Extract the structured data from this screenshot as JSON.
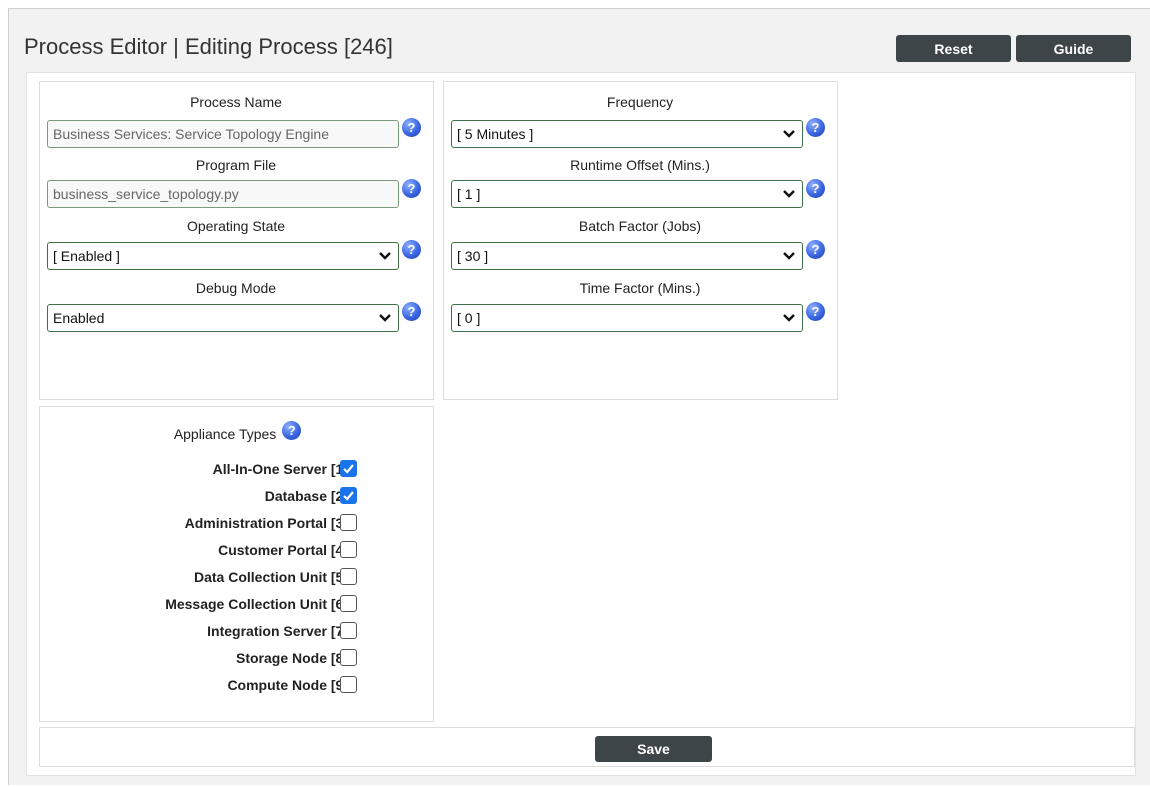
{
  "header": {
    "title": "Process Editor | Editing Process [246]",
    "reset_label": "Reset",
    "guide_label": "Guide"
  },
  "left_fields": {
    "process_name": {
      "label": "Process Name",
      "value": "Business Services: Service Topology Engine"
    },
    "program_file": {
      "label": "Program File",
      "value": "business_service_topology.py"
    },
    "operating_state": {
      "label": "Operating State",
      "value": "[ Enabled ]"
    },
    "debug_mode": {
      "label": "Debug Mode",
      "value": "Enabled"
    }
  },
  "right_fields": {
    "frequency": {
      "label": "Frequency",
      "value": "[ 5 Minutes ]"
    },
    "runtime_offset": {
      "label": "Runtime Offset (Mins.)",
      "value": "[ 1 ]"
    },
    "batch_factor": {
      "label": "Batch Factor (Jobs)",
      "value": "[ 30 ]"
    },
    "time_factor": {
      "label": "Time Factor (Mins.)",
      "value": "[ 0 ]"
    }
  },
  "appliance_types": {
    "label": "Appliance Types",
    "items": [
      {
        "label": "All-In-One Server [1]",
        "checked": true
      },
      {
        "label": "Database [2]",
        "checked": true
      },
      {
        "label": "Administration Portal [3]",
        "checked": false
      },
      {
        "label": "Customer Portal [4]",
        "checked": false
      },
      {
        "label": "Data Collection Unit [5]",
        "checked": false
      },
      {
        "label": "Message Collection Unit [6]",
        "checked": false
      },
      {
        "label": "Integration Server [7]",
        "checked": false
      },
      {
        "label": "Storage Node [8]",
        "checked": false
      },
      {
        "label": "Compute Node [9]",
        "checked": false
      }
    ]
  },
  "footer": {
    "save_label": "Save"
  },
  "icons": {
    "help": "help-icon",
    "dropdown": "chevron-down-icon",
    "check": "check-icon"
  },
  "colors": {
    "button_bg": "#3d4548",
    "checkbox_checked": "#1a73e8",
    "help_icon": "#3a66e0"
  }
}
